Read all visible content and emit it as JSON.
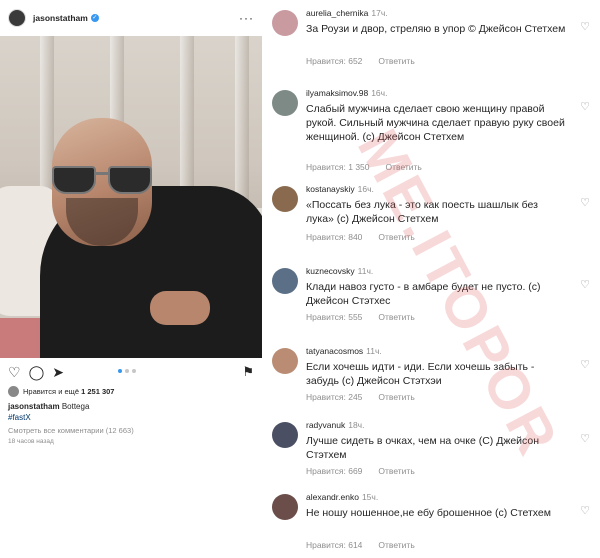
{
  "post": {
    "username": "jasonstatham",
    "likes_text": "Нравится",
    "likes_connector": "и ещё",
    "likes_count": "1 251 307",
    "caption_user": "jasonstatham",
    "caption_text": "Bottega",
    "hashtag": "#fastX",
    "view_all": "Смотреть все комментарии (12 663)",
    "time_ago": "18 часов назад",
    "carousel_total": 3,
    "carousel_active": 1
  },
  "icons": {
    "verified": "verified-badge",
    "like": "heart-icon",
    "comment": "comment-icon",
    "share": "share-icon",
    "save": "bookmark-icon",
    "more": "more-icon"
  },
  "colors": {
    "link": "#00376b",
    "muted": "#8e8e8e",
    "dot_active": "#3897f0",
    "watermark": "#dc5050"
  },
  "watermark": "ME.ITOPOR",
  "comments": [
    {
      "user": "aurelia_chernika",
      "time": "17ч.",
      "text": "За Роузи и двор, стреляю в упор © Джейсон Стетхем",
      "likes": "Нравится: 652",
      "reply": "Ответить",
      "avatar": "#c99aa0"
    },
    {
      "user": "ilyamaksimov.98",
      "time": "16ч.",
      "text": "Слабый мужчина сделает свою женщину правой рукой. Сильный мужчина сделает правую руку своей женщиной. (с) Джейсон Стетхем",
      "likes": "Нравится: 1 350",
      "reply": "Ответить",
      "avatar": "#7d8a86"
    },
    {
      "user": "kostanayskiy",
      "time": "16ч.",
      "text": "«Поссать без лука - это как поесть шашлык без лука» (с) Джейсон Стетхем",
      "likes": "Нравится: 840",
      "reply": "Ответить",
      "avatar": "#8a6a4e"
    },
    {
      "user": "kuznecovsky",
      "time": "11ч.",
      "text": "Клади навоз густо - в амбаре будет не пусто. (с) Джейсон Стэтхес",
      "likes": "Нравится: 555",
      "reply": "Ответить",
      "avatar": "#5b6f86"
    },
    {
      "user": "tatyanacosmos",
      "time": "11ч.",
      "text": "Если хочешь идти - иди. Если хочешь забыть - забудь (с) Джейсон Стэтхэи",
      "likes": "Нравится: 245",
      "reply": "Ответить",
      "avatar": "#b98c73"
    },
    {
      "user": "radyvanuk",
      "time": "18ч.",
      "text": "Лучше сидеть в очках, чем на очке (С) Джейсон Стэтхем",
      "likes": "Нравится: 669",
      "reply": "Ответить",
      "avatar": "#4a4f63"
    },
    {
      "user": "alexandr.enko",
      "time": "15ч.",
      "text": "Не ношу ношенное,не ебу брошенное (с) Стетхем",
      "likes": "Нравится: 614",
      "reply": "Ответить",
      "avatar": "#6b4e4a"
    }
  ]
}
